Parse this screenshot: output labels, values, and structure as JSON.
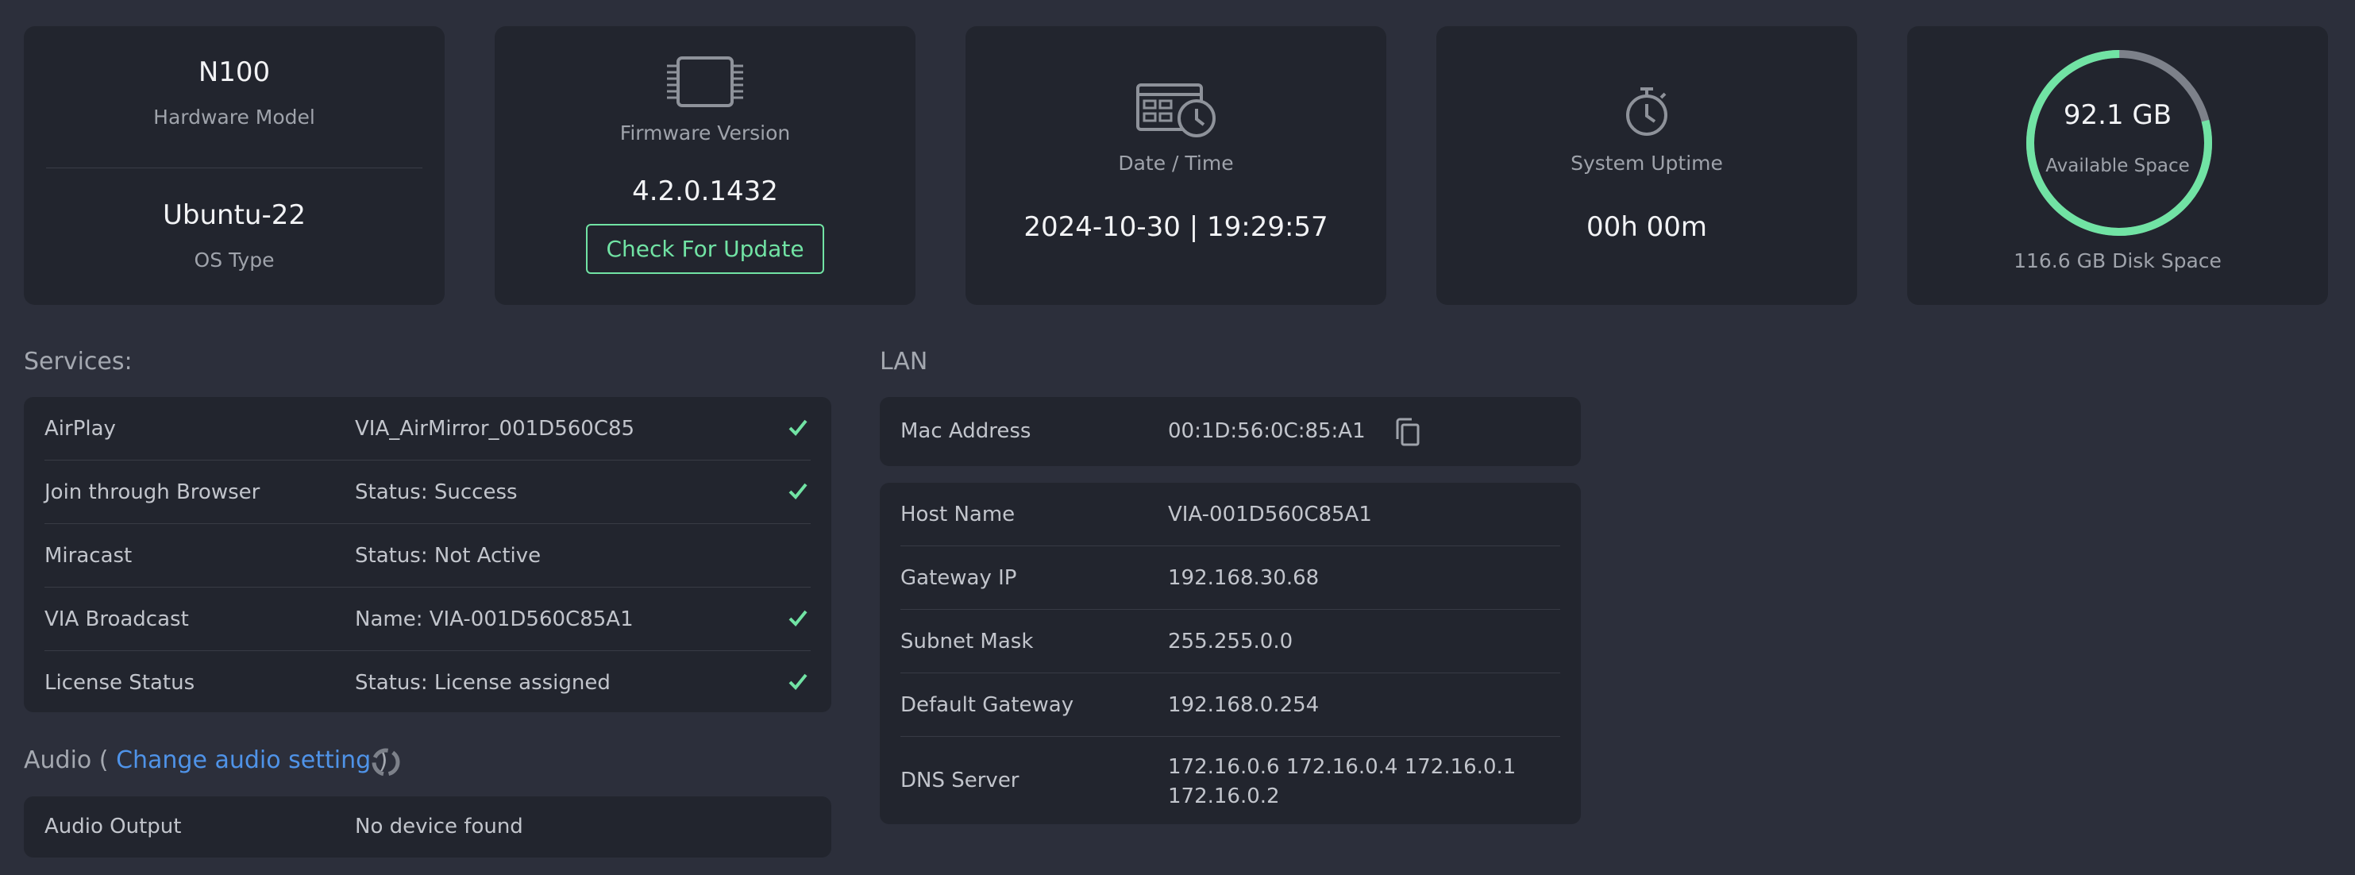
{
  "hardware": {
    "model_value": "N100",
    "model_label": "Hardware Model",
    "os_value": "Ubuntu-22",
    "os_label": "OS Type"
  },
  "firmware": {
    "icon": "chip-icon",
    "label": "Firmware Version",
    "version": "4.2.0.1432",
    "update_button": "Check For Update"
  },
  "datetime": {
    "icon": "calendar-clock-icon",
    "label": "Date / Time",
    "value": "2024-10-30 | 19:29:57"
  },
  "uptime": {
    "icon": "stopwatch-icon",
    "label": "System Uptime",
    "value": "00h 00m"
  },
  "disk": {
    "available": "92.1 GB",
    "available_label": "Available Space",
    "total": "116.6 GB Disk Space",
    "available_fraction": 0.79
  },
  "services": {
    "title": "Services:",
    "rows": [
      {
        "label": "AirPlay",
        "value": "VIA_AirMirror_001D560C85",
        "check": true
      },
      {
        "label": "Join through Browser",
        "value": "Status: Success",
        "check": true
      },
      {
        "label": "Miracast",
        "value": "Status: Not Active",
        "check": false
      },
      {
        "label": "VIA Broadcast",
        "value": "Name: VIA-001D560C85A1",
        "check": true
      },
      {
        "label": "License Status",
        "value": "Status: License assigned",
        "check": true
      }
    ]
  },
  "audio": {
    "title_prefix": "Audio (",
    "link": "Change audio setting",
    "title_suffix": ")",
    "output_label": "Audio Output",
    "output_value": "No device found"
  },
  "lan": {
    "title": "LAN",
    "mac_label": "Mac Address",
    "mac_value": "00:1D:56:0C:85:A1",
    "rows": [
      {
        "label": "Host Name",
        "value": "VIA-001D560C85A1"
      },
      {
        "label": "Gateway IP",
        "value": "192.168.30.68"
      },
      {
        "label": "Subnet Mask",
        "value": "255.255.0.0"
      },
      {
        "label": "Default Gateway",
        "value": "192.168.0.254"
      }
    ],
    "dns_label": "DNS Server",
    "dns_line1": "172.16.0.6 172.16.0.4 172.16.0.1",
    "dns_line2": "172.16.0.2"
  },
  "colors": {
    "background": "#2c2f3b",
    "card": "#22252e",
    "accent_green": "#71e3a4",
    "link_blue": "#4f93e8"
  }
}
